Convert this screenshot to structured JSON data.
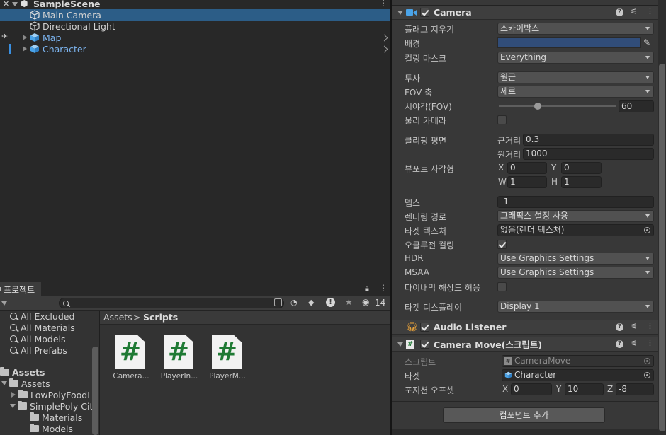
{
  "hierarchy": {
    "scene_name": "SampleScene",
    "items": [
      {
        "label": "Main Camera"
      },
      {
        "label": "Directional Light"
      },
      {
        "label": "Map"
      },
      {
        "label": "Character"
      }
    ]
  },
  "project": {
    "tab_label": "프로젝트",
    "hidden_count": "14",
    "favorites": [
      "All Excluded",
      "All Materials",
      "All Models",
      "All Prefabs"
    ],
    "assets_root": "Assets",
    "tree": [
      "Assets",
      "LowPolyFoodL",
      "SimplePoly Cit",
      "Materials",
      "Models"
    ],
    "breadcrumb_root": "Assets",
    "breadcrumb_sep": ">",
    "breadcrumb_current": "Scripts",
    "scripts": [
      {
        "name": "Camera...",
        "glyph": "#"
      },
      {
        "name": "PlayerIn...",
        "glyph": "#"
      },
      {
        "name": "PlayerM...",
        "glyph": "#"
      }
    ]
  },
  "inspector": {
    "camera": {
      "title": "Camera",
      "clear_flags_label": "플래그 지우기",
      "clear_flags_value": "스카이박스",
      "background_label": "배경",
      "background_color": "#314d79",
      "culling_mask_label": "컬링 마스크",
      "culling_mask_value": "Everything",
      "projection_label": "투사",
      "projection_value": "원근",
      "fov_axis_label": "FOV 축",
      "fov_axis_value": "세로",
      "fov_label": "시야각(FOV)",
      "fov_value": "60",
      "physical_label": "물리 카메라",
      "clipping_label": "클리핑 평면",
      "near_label": "근거리",
      "near_value": "0.3",
      "far_label": "원거리",
      "far_value": "1000",
      "viewport_label": "뷰포트 사각형",
      "vp_x_label": "X",
      "vp_x": "0",
      "vp_y_label": "Y",
      "vp_y": "0",
      "vp_w_label": "W",
      "vp_w": "1",
      "vp_h_label": "H",
      "vp_h": "1",
      "depth_label": "뎁스",
      "depth_value": "-1",
      "render_path_label": "렌더링 경로",
      "render_path_value": "그래픽스 설정 사용",
      "target_texture_label": "타겟 텍스처",
      "target_texture_value": "없음(렌더 텍스처)",
      "occlusion_label": "오클루전 컬링",
      "hdr_label": "HDR",
      "hdr_value": "Use Graphics Settings",
      "msaa_label": "MSAA",
      "msaa_value": "Use Graphics Settings",
      "dynamic_res_label": "다이내믹 해상도 허용",
      "target_display_label": "타겟 디스플레이",
      "target_display_value": "Display 1"
    },
    "audio_listener": {
      "title": "Audio Listener"
    },
    "camera_move": {
      "title": "Camera Move(스크립트)",
      "script_label": "스크립트",
      "script_value": "CameraMove",
      "target_label": "타겟",
      "target_value": "Character",
      "offset_label": "포지션 오프셋",
      "x_label": "X",
      "x": "0",
      "y_label": "Y",
      "y": "10",
      "z_label": "Z",
      "z": "-8"
    },
    "add_component_label": "컴포넌트 추가"
  },
  "colors": {
    "selection": "#2c5d87",
    "prefab_text": "#7cb4ef",
    "camera_icon": "#4aa3e8",
    "audio_icon": "#e8a23a",
    "script_hash": "#1f7a34"
  }
}
